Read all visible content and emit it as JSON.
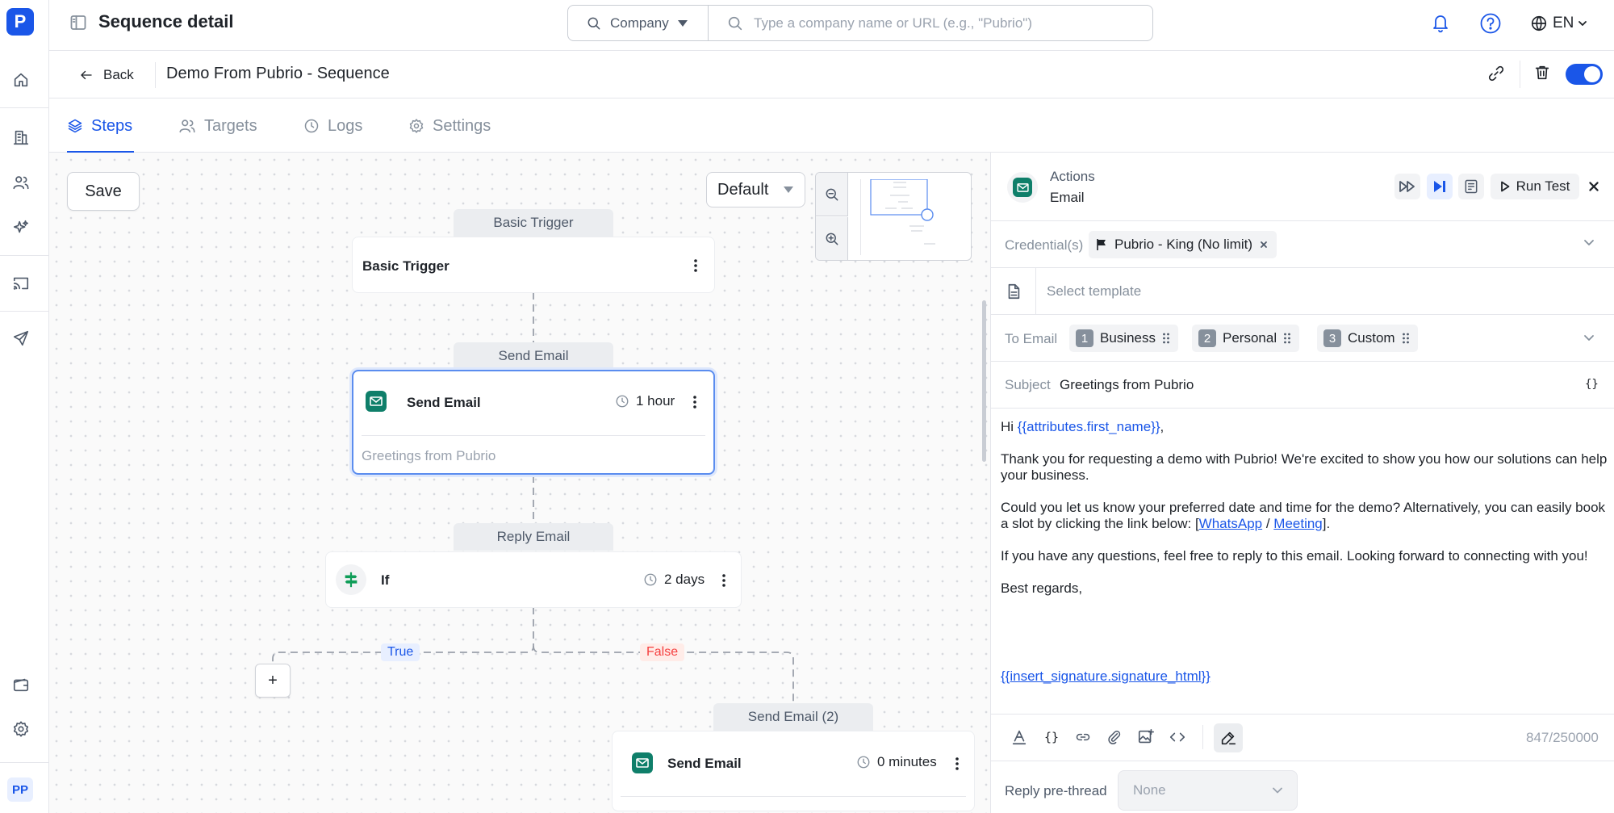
{
  "app": {
    "logo_letter": "P",
    "page_title": "Sequence detail",
    "avatar_initials": "PP"
  },
  "search": {
    "scope": "Company",
    "placeholder": "Type a company name or URL (e.g., \"Pubrio\")"
  },
  "language": "EN",
  "subheader": {
    "back_label": "Back",
    "sequence_name": "Demo From Pubrio - Sequence",
    "enabled": true
  },
  "tabs": [
    {
      "label": "Steps",
      "active": true
    },
    {
      "label": "Targets",
      "active": false
    },
    {
      "label": "Logs",
      "active": false
    },
    {
      "label": "Settings",
      "active": false
    }
  ],
  "canvas": {
    "save_label": "Save",
    "layout_select": "Default",
    "nodes": {
      "trigger": {
        "tag": "Basic Trigger",
        "title": "Basic Trigger"
      },
      "send_email": {
        "tag": "Send Email",
        "title": "Send Email",
        "delay": "1 hour",
        "subject": "Greetings from Pubrio"
      },
      "reply_email": {
        "tag": "Reply Email",
        "title": "If",
        "delay": "2 days"
      },
      "send_email_2": {
        "tag": "Send Email (2)",
        "title": "Send Email",
        "delay": "0 minutes"
      }
    },
    "branch_true": "True",
    "branch_false": "False",
    "add_label": "+"
  },
  "panel": {
    "header_category": "Actions",
    "header_type": "Email",
    "run_test_label": "Run Test",
    "credential_label": "Credential(s)",
    "credential_value": "Pubrio - King (No limit)",
    "template_placeholder": "Select template",
    "to_email_label": "To Email",
    "to_email_chips": [
      {
        "num": "1",
        "label": "Business"
      },
      {
        "num": "2",
        "label": "Personal"
      },
      {
        "num": "3",
        "label": "Custom"
      }
    ],
    "subject_label": "Subject",
    "subject_value": "Greetings from Pubrio",
    "body": {
      "greeting_prefix": "Hi ",
      "greeting_var": "{{attributes.first_name}}",
      "greeting_suffix": ",",
      "para1": "Thank you for requesting a demo with Pubrio! We're excited to show you how our solutions can help your business.",
      "para2_prefix": "Could you let us know your preferred date and time for the demo? Alternatively, you can easily book a slot by clicking the link below: [",
      "link_whatsapp": "WhatsApp",
      "link_sep": " / ",
      "link_meeting": "Meeting",
      "para2_suffix": "].",
      "para3": "If you have any questions, feel free to reply to this email. Looking forward to connecting with you!",
      "signoff": "Best regards,",
      "signature_var": "{{insert_signature.signature_html}}"
    },
    "char_count": "847/250000",
    "reply_prethread_label": "Reply pre-thread",
    "reply_prethread_value": "None"
  },
  "colors": {
    "accent": "#1a56e8",
    "email_badge": "#0f7f6a",
    "false_label": "#f53f3f"
  }
}
